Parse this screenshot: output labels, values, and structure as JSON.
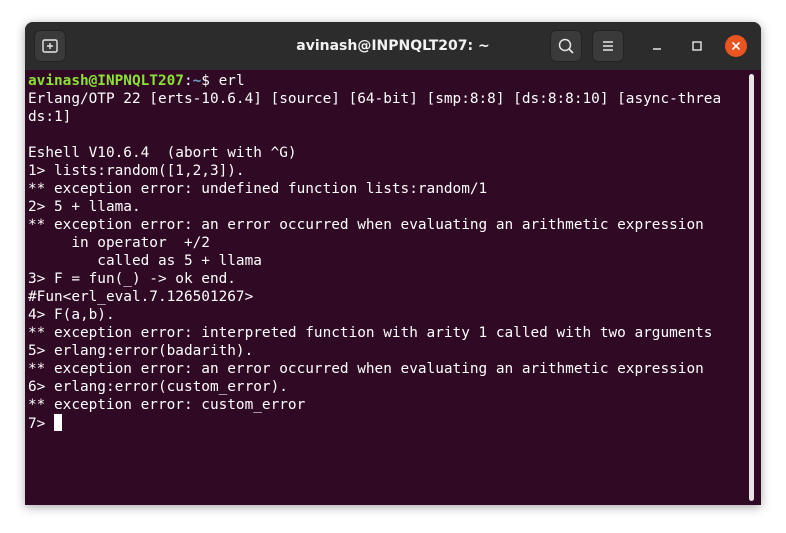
{
  "window": {
    "title": "avinash@INPNQLT207: ~"
  },
  "titlebar": {
    "icons": {
      "new_tab": "new-tab-icon",
      "search": "search-icon",
      "menu": "hamburger-menu-icon",
      "minimize": "minimize-icon",
      "maximize": "maximize-icon",
      "close": "close-icon"
    }
  },
  "terminal": {
    "prompt": {
      "user_host": "avinash@INPNQLT207",
      "colon": ":",
      "path": "~",
      "symbol": "$ ",
      "command": "erl"
    },
    "lines": [
      "Erlang/OTP 22 [erts-10.6.4] [source] [64-bit] [smp:8:8] [ds:8:8:10] [async-threa",
      "ds:1]",
      "",
      "Eshell V10.6.4  (abort with ^G)",
      "1> lists:random([1,2,3]).",
      "** exception error: undefined function lists:random/1",
      "2> 5 + llama.",
      "** exception error: an error occurred when evaluating an arithmetic expression",
      "     in operator  +/2",
      "        called as 5 + llama",
      "3> F = fun(_) -> ok end.",
      "#Fun<erl_eval.7.126501267>",
      "4> F(a,b).",
      "** exception error: interpreted function with arity 1 called with two arguments",
      "5> erlang:error(badarith).",
      "** exception error: an error occurred when evaluating an arithmetic expression",
      "6> erlang:error(custom_error).",
      "** exception error: custom_error"
    ],
    "current_prompt": "7> "
  },
  "colors": {
    "terminal_background": "#300a24",
    "titlebar_background": "#2c2c2c",
    "prompt_user": "#8ae234",
    "prompt_path": "#729fcf",
    "close_button": "#e95420"
  }
}
